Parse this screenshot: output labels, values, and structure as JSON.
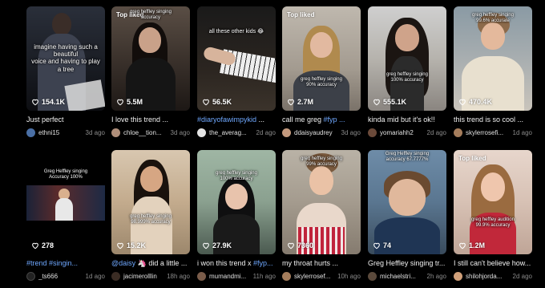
{
  "colors": {
    "background": "#000000",
    "hashtag": "#6fa8ff",
    "date": "#8a8a8a"
  },
  "row1": [
    {
      "views": "154.1K",
      "overlay": "imagine having such a beautiful\nvoice and having to play a tree",
      "badge": "",
      "caption_tag": "",
      "caption": "Just perfect",
      "user": "ethni15",
      "date": "3d ago",
      "icon": "heart-icon"
    },
    {
      "views": "5.5M",
      "overlay": "greg heffley singing\naccuracy",
      "badge": "Top liked",
      "caption_tag": "",
      "caption": "I love this trend ...",
      "user": "chloe__tion...",
      "date": "3d ago"
    },
    {
      "views": "56.5K",
      "overlay": "all these other kids 😂",
      "badge": "",
      "caption_tag": "#diaryofawimpykid",
      "caption": " ...",
      "user": "the_averag...",
      "date": "2d ago"
    },
    {
      "views": "2.7M",
      "overlay": "greg heffley singing\n90% accuracy",
      "badge": "Top liked",
      "caption_tag": "",
      "caption": "call me greg ",
      "caption_tag2": "#fyp ...",
      "user": "ddaisyaudrey",
      "date": "3d ago"
    },
    {
      "views": "555.1K",
      "overlay": "greg heffley singing\n100% accuracy",
      "badge": "",
      "caption_tag": "",
      "caption": "kinda mid but it's ok!!",
      "user": "yomariahh2",
      "date": "2d ago"
    },
    {
      "views": "470.4K",
      "overlay": "greg heffley singing\n99.6% accurate",
      "badge": "",
      "caption_tag": "",
      "caption": "this trend is so cool ...",
      "user": "skylerrosefi...",
      "date": "1d ago"
    }
  ],
  "row2": [
    {
      "views": "278",
      "overlay": "Greg Heffley singing\nAccuracy 100%",
      "badge": "",
      "caption_tag": "#trend #singin...",
      "caption": "",
      "user": "_ts666",
      "date": "1d ago"
    },
    {
      "views": "15.2K",
      "overlay": "greg heffley singing\n98.999% accuracy",
      "badge": "",
      "caption_tag": "@daisy",
      "caption": " 🦄 did a little ...",
      "user": "jacimerolllin",
      "date": "18h ago"
    },
    {
      "views": "27.9K",
      "overlay": "greg heffley singing\n100% accuracy",
      "badge": "",
      "caption_tag": "",
      "caption": "i won this trend x ",
      "caption_tag2": "#fyp...",
      "user": "mumandmi...",
      "date": "11h ago"
    },
    {
      "views": "7360",
      "overlay": "greg heffley singing\n99% accuracy",
      "badge": "",
      "caption_tag": "",
      "caption": "my throat hurts ...",
      "user": "skylerrosef...",
      "date": "10h ago"
    },
    {
      "views": "74",
      "overlay": "Greg Heffley singing\naccuracy 67.7777%",
      "badge": "",
      "caption_tag": "",
      "caption": "Greg Heffley singing tr...",
      "user": "michaelstri...",
      "date": "2h ago"
    },
    {
      "views": "1.2M",
      "overlay": "greg heffley audition\n99.9% accuracy",
      "badge": "Top liked",
      "caption_tag": "",
      "caption": "I still can't believe how...",
      "user": "shilohjorda...",
      "date": "2d ago"
    }
  ]
}
